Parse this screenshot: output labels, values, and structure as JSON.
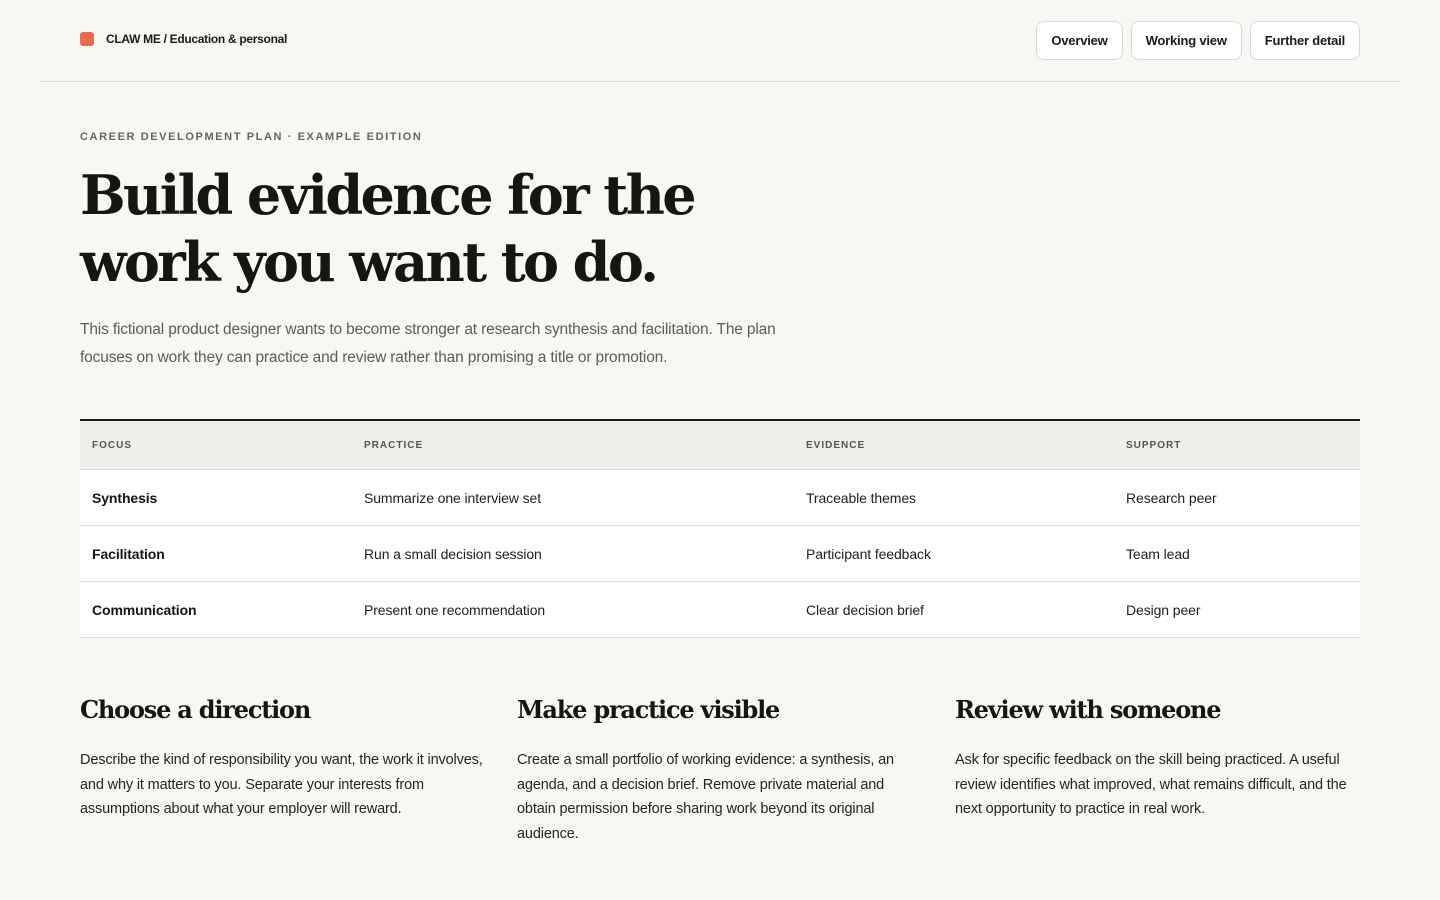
{
  "header": {
    "brand_label": "CLAW ME / Education & personal",
    "brand_color": "#ea6a4f",
    "nav": [
      {
        "label": "Overview"
      },
      {
        "label": "Working view"
      },
      {
        "label": "Further detail"
      }
    ]
  },
  "hero": {
    "eyebrow": "CAREER DEVELOPMENT PLAN · EXAMPLE EDITION",
    "headline": "Build evidence for the work you want to do.",
    "intro": "This fictional product designer wants to become stronger at research synthesis and facilitation. The plan focuses on work they can practice and review rather than promising a title or promotion."
  },
  "plan_table": {
    "columns": [
      "FOCUS",
      "PRACTICE",
      "EVIDENCE",
      "SUPPORT"
    ],
    "rows": [
      {
        "focus": "Synthesis",
        "practice": "Summarize one interview set",
        "evidence": "Traceable themes",
        "support": "Research peer"
      },
      {
        "focus": "Facilitation",
        "practice": "Run a small decision session",
        "evidence": "Participant feedback",
        "support": "Team lead"
      },
      {
        "focus": "Communication",
        "practice": "Present one recommendation",
        "evidence": "Clear decision brief",
        "support": "Design peer"
      }
    ]
  },
  "sections": [
    {
      "title": "Choose a direction",
      "body": "Describe the kind of responsibility you want, the work it involves, and why it matters to you. Separate your interests from assumptions about what your employer will reward."
    },
    {
      "title": "Make practice visible",
      "body": "Create a small portfolio of working evidence: a synthesis, an agenda, and a decision brief. Remove private material and obtain permission before sharing work beyond its original audience."
    },
    {
      "title": "Review with someone",
      "body": "Ask for specific feedback on the skill being practiced. A useful review identifies what improved, what remains difficult, and the next opportunity to practice in real work."
    }
  ]
}
